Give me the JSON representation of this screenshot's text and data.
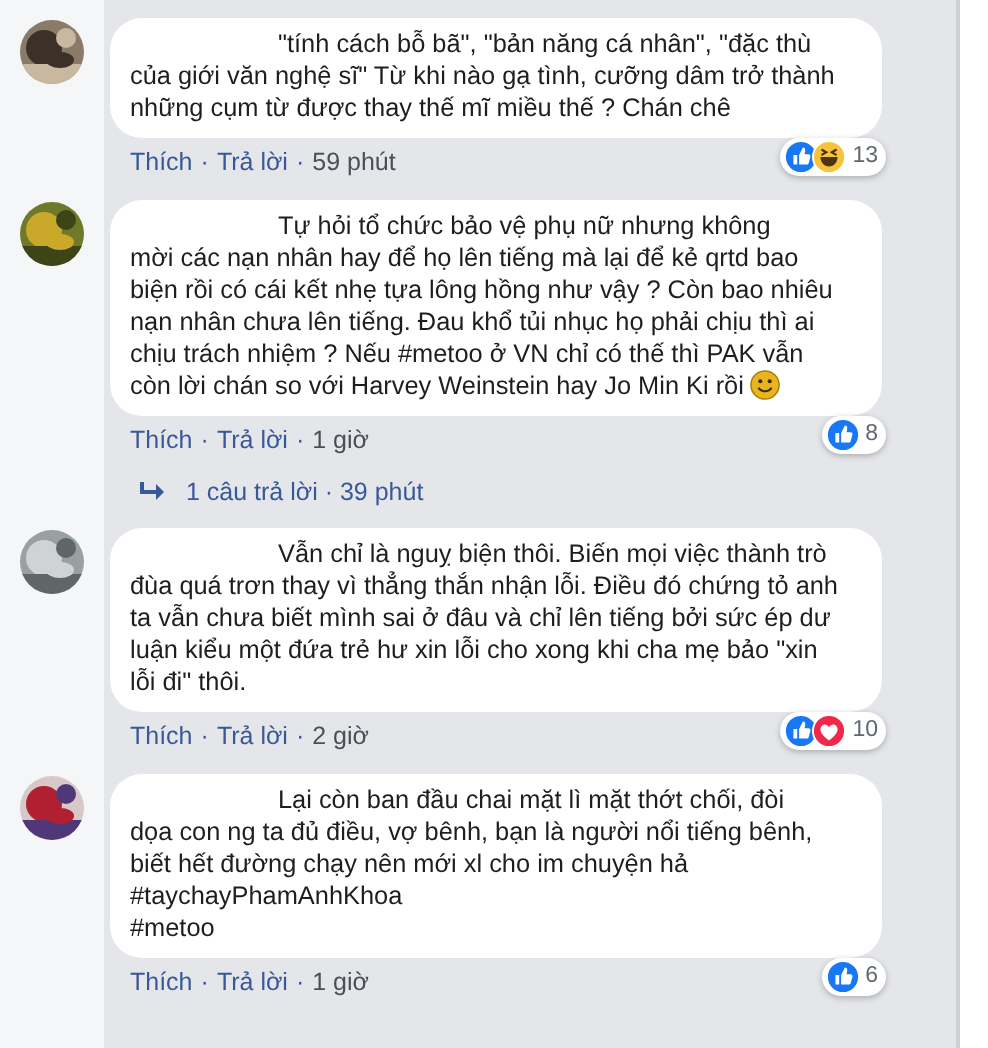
{
  "comments": [
    {
      "text": "\"tính cách bỗ bã\", \"bản năng cá nhân\", \"đặc thù\ncủa giới văn nghệ sĩ\" Từ khi nào gạ tình, cưỡng dâm trở thành\nnhững cụm từ được thay thế mĩ miều thế ? Chán chê",
      "reactions": [
        {
          "kind": "like"
        },
        {
          "kind": "haha"
        }
      ],
      "count": "13",
      "action_line": [
        {
          "kind": "link",
          "text": "Thích"
        },
        {
          "kind": "dot",
          "text": "·"
        },
        {
          "kind": "link",
          "text": "Trả lời"
        },
        {
          "kind": "dot",
          "text": "·"
        },
        {
          "kind": "time",
          "text": "59 phút"
        }
      ]
    },
    {
      "text": "Tự hỏi tổ chức bảo vệ phụ nữ nhưng không\nmời các nạn nhân hay để họ lên tiếng mà lại để kẻ qrtd bao\nbiện rồi có cái kết nhẹ tựa lông hồng như vậy ? Còn bao nhiêu\nnạn nhân chưa lên tiếng. Đau khổ tủi nhục họ phải chịu thì ai\nchịu trách nhiệm ? Nếu #metoo ở VN chỉ có thế thì PAK vẫn\ncòn lời chán so với Harvey Weinstein hay Jo Min Ki rồi",
      "emoji": true,
      "reactions": [
        {
          "kind": "like"
        }
      ],
      "count": "8",
      "action_line": [
        {
          "kind": "link",
          "text": "Thích"
        },
        {
          "kind": "dot",
          "text": "·"
        },
        {
          "kind": "link",
          "text": "Trả lời"
        },
        {
          "kind": "dot",
          "text": "·"
        },
        {
          "kind": "time",
          "text": "1 giờ"
        }
      ],
      "replies": "1 câu trả lời · 39 phút"
    },
    {
      "text": "Vẫn chỉ là nguỵ biện thôi. Biến mọi việc thành trò\nđùa quá trơn thay vì thẳng thắn nhận lỗi. Điều đó chứng tỏ anh\nta vẫn chưa biết mình sai ở đâu và chỉ lên tiếng bởi sức ép dư\nluận kiểu một đứa trẻ hư xin lỗi cho xong khi cha mẹ bảo \"xin\nlỗi đi\" thôi.",
      "reactions": [
        {
          "kind": "like"
        },
        {
          "kind": "love"
        }
      ],
      "count": "10",
      "action_line": [
        {
          "kind": "link",
          "text": "Thích"
        },
        {
          "kind": "dot",
          "text": "·"
        },
        {
          "kind": "link",
          "text": "Trả lời"
        },
        {
          "kind": "dot",
          "text": "·"
        },
        {
          "kind": "time",
          "text": "2 giờ"
        }
      ]
    },
    {
      "text": "Lại còn ban đầu chai mặt lì mặt thớt chối, đòi\ndọa con ng ta đủ điều, vợ bênh, bạn là người nổi tiếng bênh,\nbiết hết đường chạy nên mới xl cho im chuyện hả\n#taychayPhamAnhKhoa\n#metoo",
      "reactions": [
        {
          "kind": "like"
        }
      ],
      "count": "6",
      "action_line": [
        {
          "kind": "link",
          "text": "Thích"
        },
        {
          "kind": "dot",
          "text": "·"
        },
        {
          "kind": "link",
          "text": "Trả lời"
        },
        {
          "kind": "dot",
          "text": "·"
        },
        {
          "kind": "time",
          "text": "1 giờ"
        }
      ]
    }
  ]
}
